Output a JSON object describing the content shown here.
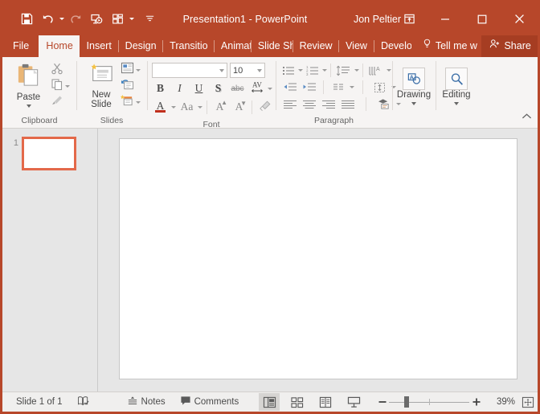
{
  "window": {
    "title": "Presentation1  -  PowerPoint",
    "user": "Jon Peltier",
    "accent_color": "#b7472a",
    "share_bg": "#a63d22"
  },
  "quick_access": {
    "items": [
      {
        "name": "save-icon",
        "label": "Save"
      },
      {
        "name": "undo-icon",
        "label": "Undo"
      },
      {
        "name": "redo-icon",
        "label": "Redo"
      },
      {
        "name": "start-slideshow-icon",
        "label": "Start From Beginning"
      },
      {
        "name": "customize-layout-icon",
        "label": "Customize Quick Access Toolbar"
      },
      {
        "name": "more-commands-icon",
        "label": "More"
      }
    ]
  },
  "window_buttons": [
    {
      "name": "ribbon-display-options-button",
      "label": "Ribbon Display Options"
    },
    {
      "name": "minimize-button",
      "label": "Minimize"
    },
    {
      "name": "maximize-button",
      "label": "Maximize"
    },
    {
      "name": "close-button",
      "label": "Close"
    }
  ],
  "tabs": [
    {
      "label": "File",
      "active": false
    },
    {
      "label": "Home",
      "active": true
    },
    {
      "label": "Insert",
      "active": false
    },
    {
      "label": "Design",
      "active": false
    },
    {
      "label": "Transitio",
      "active": false
    },
    {
      "label": "Animati",
      "active": false
    },
    {
      "label": "Slide Sho",
      "active": false
    },
    {
      "label": "Review",
      "active": false
    },
    {
      "label": "View",
      "active": false
    },
    {
      "label": "Develop",
      "active": false
    }
  ],
  "tellme": {
    "label": "Tell me w"
  },
  "share": {
    "label": "Share"
  },
  "ribbon": {
    "groups": [
      {
        "label": "Clipboard",
        "big_button": {
          "label": "Paste",
          "icon": "paste-icon"
        },
        "small_buttons": [
          {
            "label": "Cut",
            "icon": "cut-icon"
          },
          {
            "label": "Copy",
            "icon": "copy-icon"
          },
          {
            "label": "Format Painter",
            "icon": "format-painter-icon"
          }
        ]
      },
      {
        "label": "Slides",
        "big_button": {
          "label": "New Slide",
          "icon": "new-slide-icon"
        },
        "small_buttons": [
          {
            "label": "Layout",
            "icon": "layout-icon"
          },
          {
            "label": "Reset",
            "icon": "reset-icon"
          },
          {
            "label": "Section",
            "icon": "section-icon"
          }
        ]
      },
      {
        "label": "Font",
        "font_name": {
          "value": "",
          "placeholder": ""
        },
        "font_size": {
          "value": "10"
        },
        "buttons_row1": [
          "B",
          "I",
          "U",
          "S",
          "abc",
          "AV"
        ],
        "buttons_row2": [
          "A",
          "Aa",
          "A",
          "A",
          "clear"
        ]
      },
      {
        "label": "Paragraph"
      },
      {
        "label": "",
        "collapsed": [
          {
            "label": "Drawing",
            "icon": "drawing-icon"
          },
          {
            "label": "Editing",
            "icon": "editing-icon"
          }
        ]
      }
    ]
  },
  "thumbnails": [
    {
      "number": "1",
      "selected": true
    }
  ],
  "status": {
    "slide_counter": "Slide 1 of 1",
    "spellcheck_label": "Spell Check",
    "notes_label": "Notes",
    "comments_label": "Comments",
    "views": [
      {
        "name": "normal-view-button",
        "label": "Normal",
        "selected": true
      },
      {
        "name": "slide-sorter-button",
        "label": "Slide Sorter",
        "selected": false
      },
      {
        "name": "reading-view-button",
        "label": "Reading View",
        "selected": false
      },
      {
        "name": "slideshow-button",
        "label": "Slide Show",
        "selected": false
      }
    ],
    "zoom_out_label": "-",
    "zoom_in_label": "+",
    "zoom_percent": "39%",
    "fit_label": "Fit slide to current window"
  }
}
